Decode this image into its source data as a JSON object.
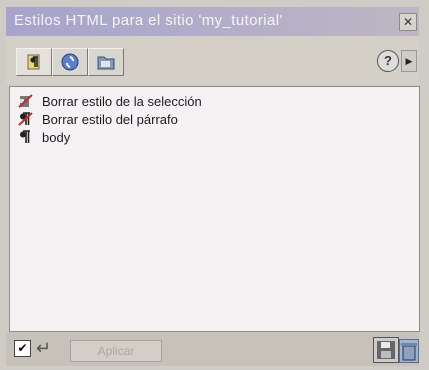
{
  "window": {
    "title": "Estilos HTML para el sitio 'my_tutorial'"
  },
  "toolbar": {
    "tabs": [
      {
        "name": "paragraph-styles-tab",
        "icon": "paragraph-icon"
      },
      {
        "name": "link-styles-tab",
        "icon": "link-icon"
      },
      {
        "name": "site-files-tab",
        "icon": "folder-icon"
      }
    ],
    "help_icon": "help-icon",
    "menu_icon": "panel-menu-icon"
  },
  "styles": [
    {
      "label": "Borrar estilo de la selección",
      "icon": "clear-selection-style-icon"
    },
    {
      "label": "Borrar estilo del párrafo",
      "icon": "clear-paragraph-style-icon"
    },
    {
      "label": "body",
      "icon": "paragraph-icon"
    }
  ],
  "statusbar": {
    "apply_label": "Aplicar",
    "auto_apply_checked": true
  },
  "colors": {
    "title_bar": "#a7a3cc",
    "panel_bg": "#d4d0c8",
    "list_bg": "#f4f2f3",
    "clear_mark": "#cc2a2a"
  }
}
